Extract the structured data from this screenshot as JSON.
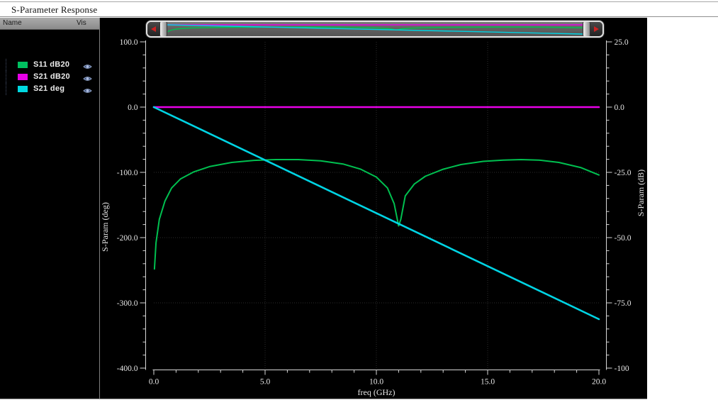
{
  "window": {
    "title": "S-Parameter Response"
  },
  "legend_panel": {
    "columns": {
      "name": "Name",
      "vis": "Vis"
    },
    "vis_icon": "eye-icon",
    "items": [
      {
        "label": "S11 dB20",
        "color": "#00c060"
      },
      {
        "label": "S21 dB20",
        "color": "#e800e8"
      },
      {
        "label": "S21 deg",
        "color": "#00d8e0"
      }
    ]
  },
  "scrollbar": {
    "arrow_color": "#cc2222",
    "left_arrow_icon": "scroll-left-arrow-icon",
    "right_arrow_icon": "scroll-right-arrow-icon"
  },
  "chart_data": {
    "type": "line",
    "title": "S-Parameter Response",
    "xlabel": "freq (GHz)",
    "ylabel_left": "S-Param (deg)",
    "ylabel_right": "S-Param (dB)",
    "xlim": [
      0,
      20
    ],
    "ylim_left": [
      -400,
      100
    ],
    "ylim_right": [
      -100,
      25
    ],
    "x_tick_labels": [
      "0.0",
      "5.0",
      "10.0",
      "15.0",
      "20.0"
    ],
    "x_tick_values": [
      0,
      5,
      10,
      15,
      20
    ],
    "x_minor_step": 1,
    "y_left_tick_labels": [
      "100.0",
      "0.0",
      "-100.0",
      "-200.0",
      "-300.0",
      "-400.0"
    ],
    "y_left_tick_values": [
      100,
      0,
      -100,
      -200,
      -300,
      -400
    ],
    "y_left_minor_step": 20,
    "y_right_tick_labels": [
      "25.0",
      "0.0",
      "-25.0",
      "-50.0",
      "-75.0",
      "-100"
    ],
    "y_right_tick_values": [
      25,
      0,
      -25,
      -50,
      -75,
      -100
    ],
    "y_right_minor_step": 5,
    "grid": "dotted",
    "background": "#000000",
    "axis_color": "#d8d8d8",
    "grid_color": "#2d2d2d",
    "series": [
      {
        "name": "S11 dB20",
        "axis": "right",
        "color": "#00c050",
        "x": [
          0.03,
          0.1,
          0.25,
          0.5,
          0.8,
          1.2,
          1.8,
          2.5,
          3.5,
          4.5,
          5.5,
          6.5,
          7.5,
          8.5,
          9.3,
          10.0,
          10.5,
          10.8,
          11.0,
          11.1,
          11.3,
          11.7,
          12.2,
          13.0,
          13.8,
          14.8,
          15.7,
          16.5,
          17.3,
          18.2,
          19.2,
          20.0
        ],
        "y": [
          -62,
          -52,
          -43,
          -36,
          -31,
          -27.5,
          -24.8,
          -22.8,
          -21.2,
          -20.4,
          -20.1,
          -20.1,
          -20.6,
          -21.8,
          -23.8,
          -26.8,
          -31,
          -37,
          -45.5,
          -43,
          -34,
          -29.5,
          -26.5,
          -23.8,
          -22,
          -20.8,
          -20.3,
          -20.1,
          -20.3,
          -21.2,
          -23.2,
          -26
        ]
      },
      {
        "name": "S21 dB20",
        "axis": "right",
        "color": "#e800e8",
        "x": [
          0,
          20
        ],
        "y": [
          0,
          0
        ]
      },
      {
        "name": "S21 deg",
        "axis": "left",
        "color": "#00d4e4",
        "x": [
          0,
          20
        ],
        "y": [
          0,
          -325
        ]
      }
    ]
  }
}
